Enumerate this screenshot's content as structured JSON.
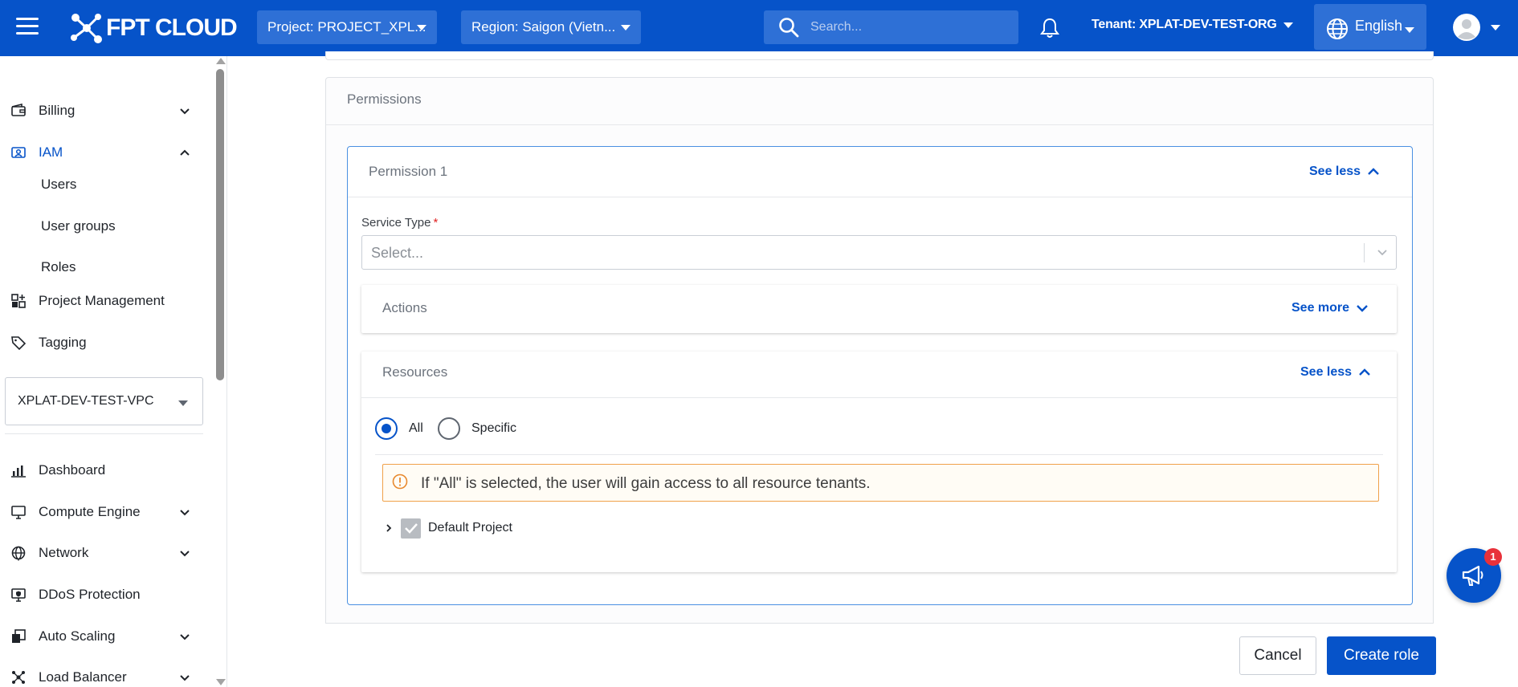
{
  "header": {
    "logo_text": "FPT CLOUD",
    "project_label": "Project: PROJECT_XPL...",
    "region_label": "Region: Saigon (Vietn...",
    "search_placeholder": "Search...",
    "tenant_label": "Tenant: XPLAT-DEV-TEST-ORG",
    "language": "English",
    "brand_color": "#0653c9"
  },
  "sidebar": {
    "top_items": [
      {
        "label": "Billing",
        "icon": "wallet-icon",
        "expanded": false
      },
      {
        "label": "IAM",
        "icon": "id-card-icon",
        "expanded": true,
        "active": true
      }
    ],
    "iam_children": [
      "Users",
      "User groups",
      "Roles"
    ],
    "mid_items": [
      {
        "label": "Project Management",
        "icon": "grid-plus-icon"
      },
      {
        "label": "Tagging",
        "icon": "tag-icon"
      }
    ],
    "vpc_select": "XPLAT-DEV-TEST-VPC",
    "bottom_items": [
      {
        "label": "Dashboard",
        "icon": "bar-chart-icon",
        "expandable": false
      },
      {
        "label": "Compute Engine",
        "icon": "monitor-icon",
        "expandable": true
      },
      {
        "label": "Network",
        "icon": "globe-icon",
        "expandable": true
      },
      {
        "label": "DDoS Protection",
        "icon": "shield-monitor-icon",
        "expandable": false
      },
      {
        "label": "Auto Scaling",
        "icon": "scaling-icon",
        "expandable": true
      },
      {
        "label": "Load Balancer",
        "icon": "load-balancer-icon",
        "expandable": true
      }
    ]
  },
  "main": {
    "permissions_title": "Permissions",
    "permission": {
      "title": "Permission 1",
      "see_less": "See less",
      "service_type_label": "Service Type",
      "required_mark": "*",
      "service_type_placeholder": "Select...",
      "actions": {
        "title": "Actions",
        "toggle": "See more"
      },
      "resources": {
        "title": "Resources",
        "toggle": "See less",
        "options": [
          "All",
          "Specific"
        ],
        "selected": "All",
        "warning": "If \"All\" is selected, the user will gain access to all resource tenants.",
        "tree_item": "Default Project",
        "tree_item_checked": true
      }
    }
  },
  "footer": {
    "cancel": "Cancel",
    "create": "Create role"
  },
  "fab": {
    "badge": "1"
  }
}
